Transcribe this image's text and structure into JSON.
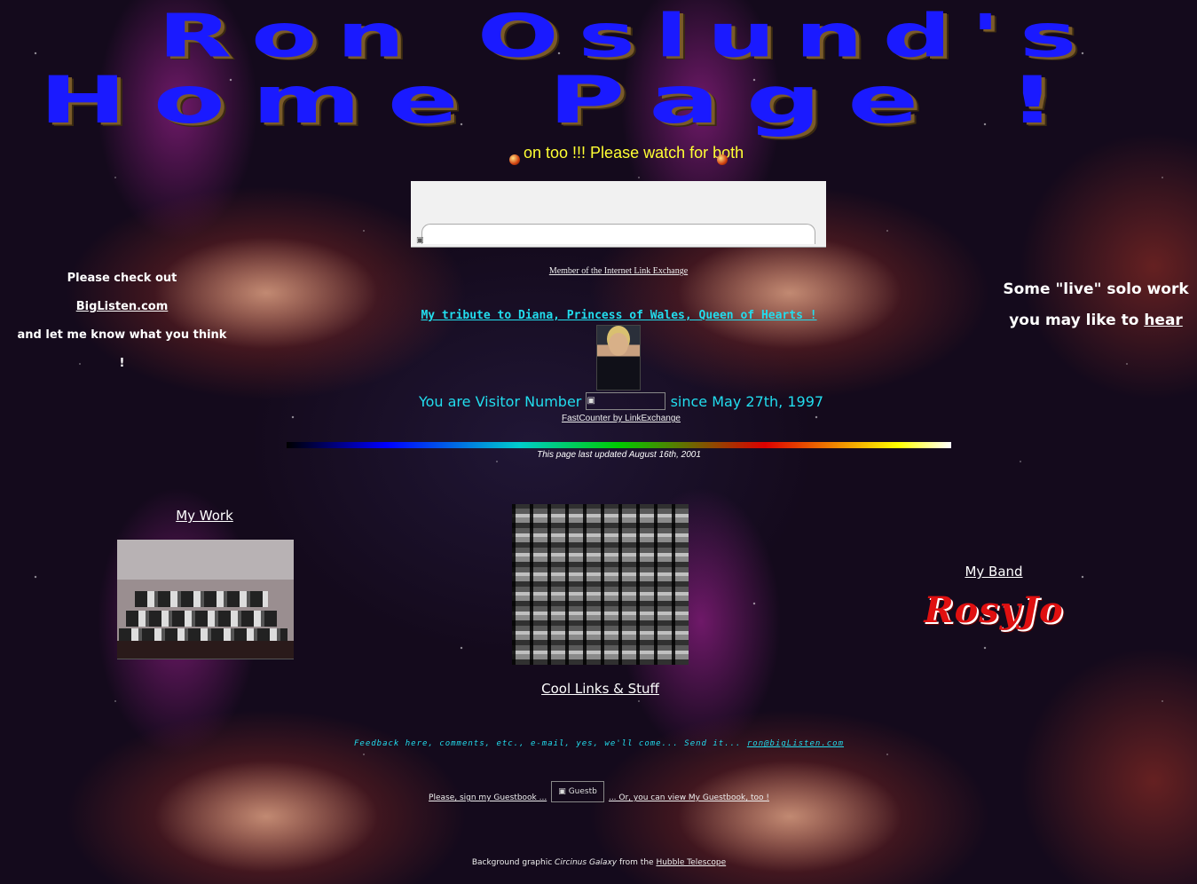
{
  "header": {
    "title_line1": "Ron Oslund's",
    "title_line2": "Home Page !"
  },
  "marquee": {
    "text": "on too !!! Please watch for both"
  },
  "banner": {
    "broken_icon": "broken-image-icon",
    "member_text": "Member of the Internet Link Exchange"
  },
  "left_column": {
    "line1": "Please check out",
    "link": "BigListen.com",
    "line3": "and let me know what you think !"
  },
  "right_column": {
    "line1": "Some \"live\" solo work",
    "line2_prefix": "you may like to",
    "link": "hear"
  },
  "tribute": {
    "link": "My tribute to Diana, Princess of Wales, Queen of Hearts !"
  },
  "visitor": {
    "prefix": "You are Visitor Number",
    "suffix": "since May 27th, 1997",
    "counter_credit": "FastCounter by LinkExchange"
  },
  "updated": "This page last updated August 16th, 2001",
  "sections": {
    "my_work": "My Work",
    "cool_links": "Cool Links & Stuff",
    "my_band": "My Band",
    "band_logo_text": "RosyJo"
  },
  "contact": {
    "text": "Feedback here, comments, etc., e-mail, yes, we'll come... Send it... ",
    "email": "ron@bigListen.com"
  },
  "guestbook": {
    "sign_link": "Please, sign my Guestbook ...",
    "button_label": "Guestb",
    "view_link": "... Or, you can view My Guestbook, too !"
  },
  "credit": {
    "prefix": "Background graphic",
    "image_name": "Circinus Galaxy",
    "middle": "from the",
    "link": "Hubble Telescope"
  },
  "colors": {
    "title_blue": "#1a1aff",
    "marquee_yellow": "#ffff33",
    "cyan_text": "#22ddee",
    "band_red": "#e01010"
  }
}
